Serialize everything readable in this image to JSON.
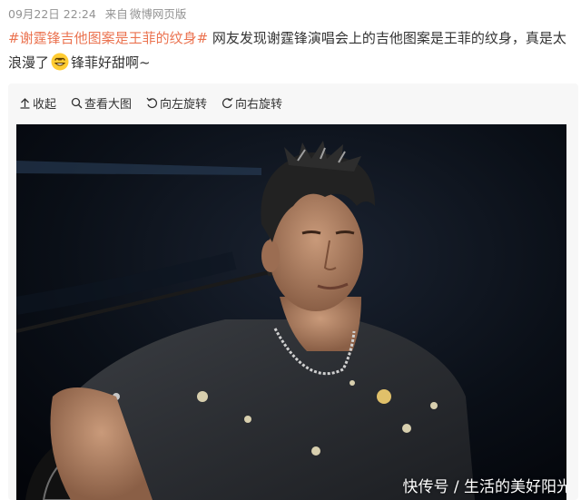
{
  "post": {
    "date": "09月22日 22:24",
    "source_prefix": "来自",
    "source": "微博网页版",
    "topic": "#谢霆锋吉他图案是王菲的纹身#",
    "text_main": " 网友发现谢霆锋演唱会上的吉他图案是王菲的纹身，真是太浪漫了",
    "emoji_icon": "smiling-heart-eyes-emoji",
    "text_tail": "锋菲好甜啊~"
  },
  "toolbar": {
    "collapse_label": "收起",
    "view_large_label": "查看大图",
    "rotate_left_label": "向左旋转",
    "rotate_right_label": "向右旋转"
  },
  "photo": {
    "watermark": "快传号 / 生活的美好阳光"
  },
  "colors": {
    "topic": "#eb7350",
    "meta": "#939393",
    "card_bg": "#f7f7f7"
  }
}
